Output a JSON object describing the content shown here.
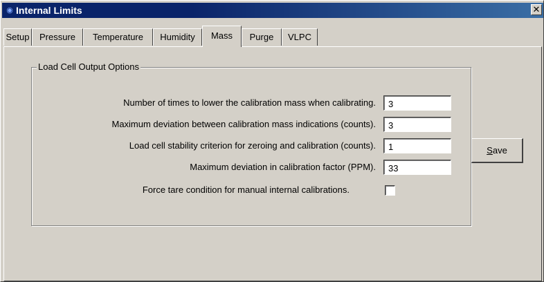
{
  "window": {
    "title": "Internal Limits",
    "close_glyph": "✕",
    "title_icon": "app-icon"
  },
  "tabs": [
    {
      "label": "Setup",
      "active": false
    },
    {
      "label": "Pressure",
      "active": false
    },
    {
      "label": "Temperature",
      "active": false
    },
    {
      "label": "Humidity",
      "active": false
    },
    {
      "label": "Mass",
      "active": true
    },
    {
      "label": "Purge",
      "active": false
    },
    {
      "label": "VLPC",
      "active": false
    }
  ],
  "group": {
    "title": "Load Cell Output Options",
    "rows": [
      {
        "label": "Number of times to lower the calibration mass when calibrating.",
        "value": "3"
      },
      {
        "label": "Maximum deviation between calibration  mass indications (counts).",
        "value": "3"
      },
      {
        "label": "Load cell stability criterion for zeroing and calibration (counts).",
        "value": "1"
      },
      {
        "label": "Maximum deviation in calibration factor (PPM).",
        "value": "33"
      }
    ],
    "checkbox": {
      "label": "Force tare condition for manual internal calibrations.",
      "checked": false
    }
  },
  "save_button": {
    "mnemonic": "S",
    "rest": "ave"
  },
  "colors": {
    "titlebar": "#0a246a",
    "face": "#d4d0c8"
  }
}
